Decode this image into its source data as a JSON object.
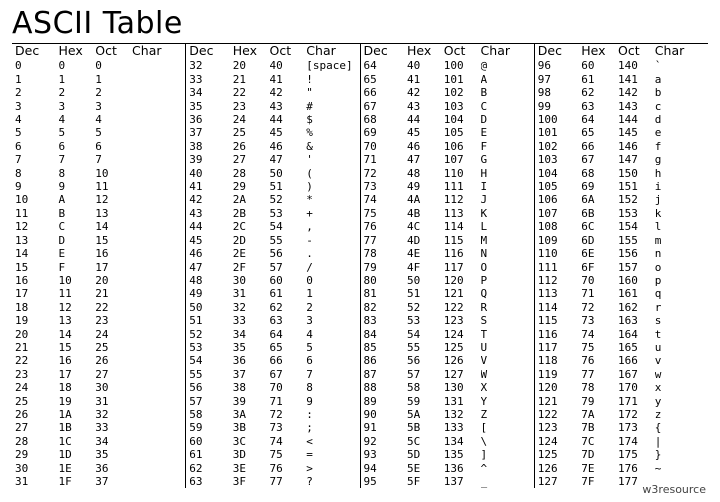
{
  "title": "ASCII Table",
  "footer": "w3resource",
  "headers": {
    "dec": "Dec",
    "hex": "Hex",
    "oct": "Oct",
    "char": "Char"
  },
  "blocks": [
    [
      {
        "dec": "0",
        "hex": "0",
        "oct": "0",
        "char": ""
      },
      {
        "dec": "1",
        "hex": "1",
        "oct": "1",
        "char": ""
      },
      {
        "dec": "2",
        "hex": "2",
        "oct": "2",
        "char": ""
      },
      {
        "dec": "3",
        "hex": "3",
        "oct": "3",
        "char": ""
      },
      {
        "dec": "4",
        "hex": "4",
        "oct": "4",
        "char": ""
      },
      {
        "dec": "5",
        "hex": "5",
        "oct": "5",
        "char": ""
      },
      {
        "dec": "6",
        "hex": "6",
        "oct": "6",
        "char": ""
      },
      {
        "dec": "7",
        "hex": "7",
        "oct": "7",
        "char": ""
      },
      {
        "dec": "8",
        "hex": "8",
        "oct": "10",
        "char": ""
      },
      {
        "dec": "9",
        "hex": "9",
        "oct": "11",
        "char": ""
      },
      {
        "dec": "10",
        "hex": "A",
        "oct": "12",
        "char": ""
      },
      {
        "dec": "11",
        "hex": "B",
        "oct": "13",
        "char": ""
      },
      {
        "dec": "12",
        "hex": "C",
        "oct": "14",
        "char": ""
      },
      {
        "dec": "13",
        "hex": "D",
        "oct": "15",
        "char": ""
      },
      {
        "dec": "14",
        "hex": "E",
        "oct": "16",
        "char": ""
      },
      {
        "dec": "15",
        "hex": "F",
        "oct": "17",
        "char": ""
      },
      {
        "dec": "16",
        "hex": "10",
        "oct": "20",
        "char": ""
      },
      {
        "dec": "17",
        "hex": "11",
        "oct": "21",
        "char": ""
      },
      {
        "dec": "18",
        "hex": "12",
        "oct": "22",
        "char": ""
      },
      {
        "dec": "19",
        "hex": "13",
        "oct": "23",
        "char": ""
      },
      {
        "dec": "20",
        "hex": "14",
        "oct": "24",
        "char": ""
      },
      {
        "dec": "21",
        "hex": "15",
        "oct": "25",
        "char": ""
      },
      {
        "dec": "22",
        "hex": "16",
        "oct": "26",
        "char": ""
      },
      {
        "dec": "23",
        "hex": "17",
        "oct": "27",
        "char": ""
      },
      {
        "dec": "24",
        "hex": "18",
        "oct": "30",
        "char": ""
      },
      {
        "dec": "25",
        "hex": "19",
        "oct": "31",
        "char": ""
      },
      {
        "dec": "26",
        "hex": "1A",
        "oct": "32",
        "char": ""
      },
      {
        "dec": "27",
        "hex": "1B",
        "oct": "33",
        "char": ""
      },
      {
        "dec": "28",
        "hex": "1C",
        "oct": "34",
        "char": ""
      },
      {
        "dec": "29",
        "hex": "1D",
        "oct": "35",
        "char": ""
      },
      {
        "dec": "30",
        "hex": "1E",
        "oct": "36",
        "char": ""
      },
      {
        "dec": "31",
        "hex": "1F",
        "oct": "37",
        "char": ""
      }
    ],
    [
      {
        "dec": "32",
        "hex": "20",
        "oct": "40",
        "char": "[space]"
      },
      {
        "dec": "33",
        "hex": "21",
        "oct": "41",
        "char": "!"
      },
      {
        "dec": "34",
        "hex": "22",
        "oct": "42",
        "char": "\""
      },
      {
        "dec": "35",
        "hex": "23",
        "oct": "43",
        "char": "#"
      },
      {
        "dec": "36",
        "hex": "24",
        "oct": "44",
        "char": "$"
      },
      {
        "dec": "37",
        "hex": "25",
        "oct": "45",
        "char": "%"
      },
      {
        "dec": "38",
        "hex": "26",
        "oct": "46",
        "char": "&"
      },
      {
        "dec": "39",
        "hex": "27",
        "oct": "47",
        "char": "'"
      },
      {
        "dec": "40",
        "hex": "28",
        "oct": "50",
        "char": "("
      },
      {
        "dec": "41",
        "hex": "29",
        "oct": "51",
        "char": ")"
      },
      {
        "dec": "42",
        "hex": "2A",
        "oct": "52",
        "char": "*"
      },
      {
        "dec": "43",
        "hex": "2B",
        "oct": "53",
        "char": "+"
      },
      {
        "dec": "44",
        "hex": "2C",
        "oct": "54",
        "char": ","
      },
      {
        "dec": "45",
        "hex": "2D",
        "oct": "55",
        "char": "-"
      },
      {
        "dec": "46",
        "hex": "2E",
        "oct": "56",
        "char": "."
      },
      {
        "dec": "47",
        "hex": "2F",
        "oct": "57",
        "char": "/"
      },
      {
        "dec": "48",
        "hex": "30",
        "oct": "60",
        "char": "0"
      },
      {
        "dec": "49",
        "hex": "31",
        "oct": "61",
        "char": "1"
      },
      {
        "dec": "50",
        "hex": "32",
        "oct": "62",
        "char": "2"
      },
      {
        "dec": "51",
        "hex": "33",
        "oct": "63",
        "char": "3"
      },
      {
        "dec": "52",
        "hex": "34",
        "oct": "64",
        "char": "4"
      },
      {
        "dec": "53",
        "hex": "35",
        "oct": "65",
        "char": "5"
      },
      {
        "dec": "54",
        "hex": "36",
        "oct": "66",
        "char": "6"
      },
      {
        "dec": "55",
        "hex": "37",
        "oct": "67",
        "char": "7"
      },
      {
        "dec": "56",
        "hex": "38",
        "oct": "70",
        "char": "8"
      },
      {
        "dec": "57",
        "hex": "39",
        "oct": "71",
        "char": "9"
      },
      {
        "dec": "58",
        "hex": "3A",
        "oct": "72",
        "char": ":"
      },
      {
        "dec": "59",
        "hex": "3B",
        "oct": "73",
        "char": ";"
      },
      {
        "dec": "60",
        "hex": "3C",
        "oct": "74",
        "char": "<"
      },
      {
        "dec": "61",
        "hex": "3D",
        "oct": "75",
        "char": "="
      },
      {
        "dec": "62",
        "hex": "3E",
        "oct": "76",
        "char": ">"
      },
      {
        "dec": "63",
        "hex": "3F",
        "oct": "77",
        "char": "?"
      }
    ],
    [
      {
        "dec": "64",
        "hex": "40",
        "oct": "100",
        "char": "@"
      },
      {
        "dec": "65",
        "hex": "41",
        "oct": "101",
        "char": "A"
      },
      {
        "dec": "66",
        "hex": "42",
        "oct": "102",
        "char": "B"
      },
      {
        "dec": "67",
        "hex": "43",
        "oct": "103",
        "char": "C"
      },
      {
        "dec": "68",
        "hex": "44",
        "oct": "104",
        "char": "D"
      },
      {
        "dec": "69",
        "hex": "45",
        "oct": "105",
        "char": "E"
      },
      {
        "dec": "70",
        "hex": "46",
        "oct": "106",
        "char": "F"
      },
      {
        "dec": "71",
        "hex": "47",
        "oct": "107",
        "char": "G"
      },
      {
        "dec": "72",
        "hex": "48",
        "oct": "110",
        "char": "H"
      },
      {
        "dec": "73",
        "hex": "49",
        "oct": "111",
        "char": "I"
      },
      {
        "dec": "74",
        "hex": "4A",
        "oct": "112",
        "char": "J"
      },
      {
        "dec": "75",
        "hex": "4B",
        "oct": "113",
        "char": "K"
      },
      {
        "dec": "76",
        "hex": "4C",
        "oct": "114",
        "char": "L"
      },
      {
        "dec": "77",
        "hex": "4D",
        "oct": "115",
        "char": "M"
      },
      {
        "dec": "78",
        "hex": "4E",
        "oct": "116",
        "char": "N"
      },
      {
        "dec": "79",
        "hex": "4F",
        "oct": "117",
        "char": "O"
      },
      {
        "dec": "80",
        "hex": "50",
        "oct": "120",
        "char": "P"
      },
      {
        "dec": "81",
        "hex": "51",
        "oct": "121",
        "char": "Q"
      },
      {
        "dec": "82",
        "hex": "52",
        "oct": "122",
        "char": "R"
      },
      {
        "dec": "83",
        "hex": "53",
        "oct": "123",
        "char": "S"
      },
      {
        "dec": "84",
        "hex": "54",
        "oct": "124",
        "char": "T"
      },
      {
        "dec": "85",
        "hex": "55",
        "oct": "125",
        "char": "U"
      },
      {
        "dec": "86",
        "hex": "56",
        "oct": "126",
        "char": "V"
      },
      {
        "dec": "87",
        "hex": "57",
        "oct": "127",
        "char": "W"
      },
      {
        "dec": "88",
        "hex": "58",
        "oct": "130",
        "char": "X"
      },
      {
        "dec": "89",
        "hex": "59",
        "oct": "131",
        "char": "Y"
      },
      {
        "dec": "90",
        "hex": "5A",
        "oct": "132",
        "char": "Z"
      },
      {
        "dec": "91",
        "hex": "5B",
        "oct": "133",
        "char": "["
      },
      {
        "dec": "92",
        "hex": "5C",
        "oct": "134",
        "char": "\\"
      },
      {
        "dec": "93",
        "hex": "5D",
        "oct": "135",
        "char": "]"
      },
      {
        "dec": "94",
        "hex": "5E",
        "oct": "136",
        "char": "^"
      },
      {
        "dec": "95",
        "hex": "5F",
        "oct": "137",
        "char": "_"
      }
    ],
    [
      {
        "dec": "96",
        "hex": "60",
        "oct": "140",
        "char": "`"
      },
      {
        "dec": "97",
        "hex": "61",
        "oct": "141",
        "char": "a"
      },
      {
        "dec": "98",
        "hex": "62",
        "oct": "142",
        "char": "b"
      },
      {
        "dec": "99",
        "hex": "63",
        "oct": "143",
        "char": "c"
      },
      {
        "dec": "100",
        "hex": "64",
        "oct": "144",
        "char": "d"
      },
      {
        "dec": "101",
        "hex": "65",
        "oct": "145",
        "char": "e"
      },
      {
        "dec": "102",
        "hex": "66",
        "oct": "146",
        "char": "f"
      },
      {
        "dec": "103",
        "hex": "67",
        "oct": "147",
        "char": "g"
      },
      {
        "dec": "104",
        "hex": "68",
        "oct": "150",
        "char": "h"
      },
      {
        "dec": "105",
        "hex": "69",
        "oct": "151",
        "char": "i"
      },
      {
        "dec": "106",
        "hex": "6A",
        "oct": "152",
        "char": "j"
      },
      {
        "dec": "107",
        "hex": "6B",
        "oct": "153",
        "char": "k"
      },
      {
        "dec": "108",
        "hex": "6C",
        "oct": "154",
        "char": "l"
      },
      {
        "dec": "109",
        "hex": "6D",
        "oct": "155",
        "char": "m"
      },
      {
        "dec": "110",
        "hex": "6E",
        "oct": "156",
        "char": "n"
      },
      {
        "dec": "111",
        "hex": "6F",
        "oct": "157",
        "char": "o"
      },
      {
        "dec": "112",
        "hex": "70",
        "oct": "160",
        "char": "p"
      },
      {
        "dec": "113",
        "hex": "71",
        "oct": "161",
        "char": "q"
      },
      {
        "dec": "114",
        "hex": "72",
        "oct": "162",
        "char": "r"
      },
      {
        "dec": "115",
        "hex": "73",
        "oct": "163",
        "char": "s"
      },
      {
        "dec": "116",
        "hex": "74",
        "oct": "164",
        "char": "t"
      },
      {
        "dec": "117",
        "hex": "75",
        "oct": "165",
        "char": "u"
      },
      {
        "dec": "118",
        "hex": "76",
        "oct": "166",
        "char": "v"
      },
      {
        "dec": "119",
        "hex": "77",
        "oct": "167",
        "char": "w"
      },
      {
        "dec": "120",
        "hex": "78",
        "oct": "170",
        "char": "x"
      },
      {
        "dec": "121",
        "hex": "79",
        "oct": "171",
        "char": "y"
      },
      {
        "dec": "122",
        "hex": "7A",
        "oct": "172",
        "char": "z"
      },
      {
        "dec": "123",
        "hex": "7B",
        "oct": "173",
        "char": "{"
      },
      {
        "dec": "124",
        "hex": "7C",
        "oct": "174",
        "char": "|"
      },
      {
        "dec": "125",
        "hex": "7D",
        "oct": "175",
        "char": "}"
      },
      {
        "dec": "126",
        "hex": "7E",
        "oct": "176",
        "char": "~"
      },
      {
        "dec": "127",
        "hex": "7F",
        "oct": "177",
        "char": ""
      }
    ]
  ]
}
